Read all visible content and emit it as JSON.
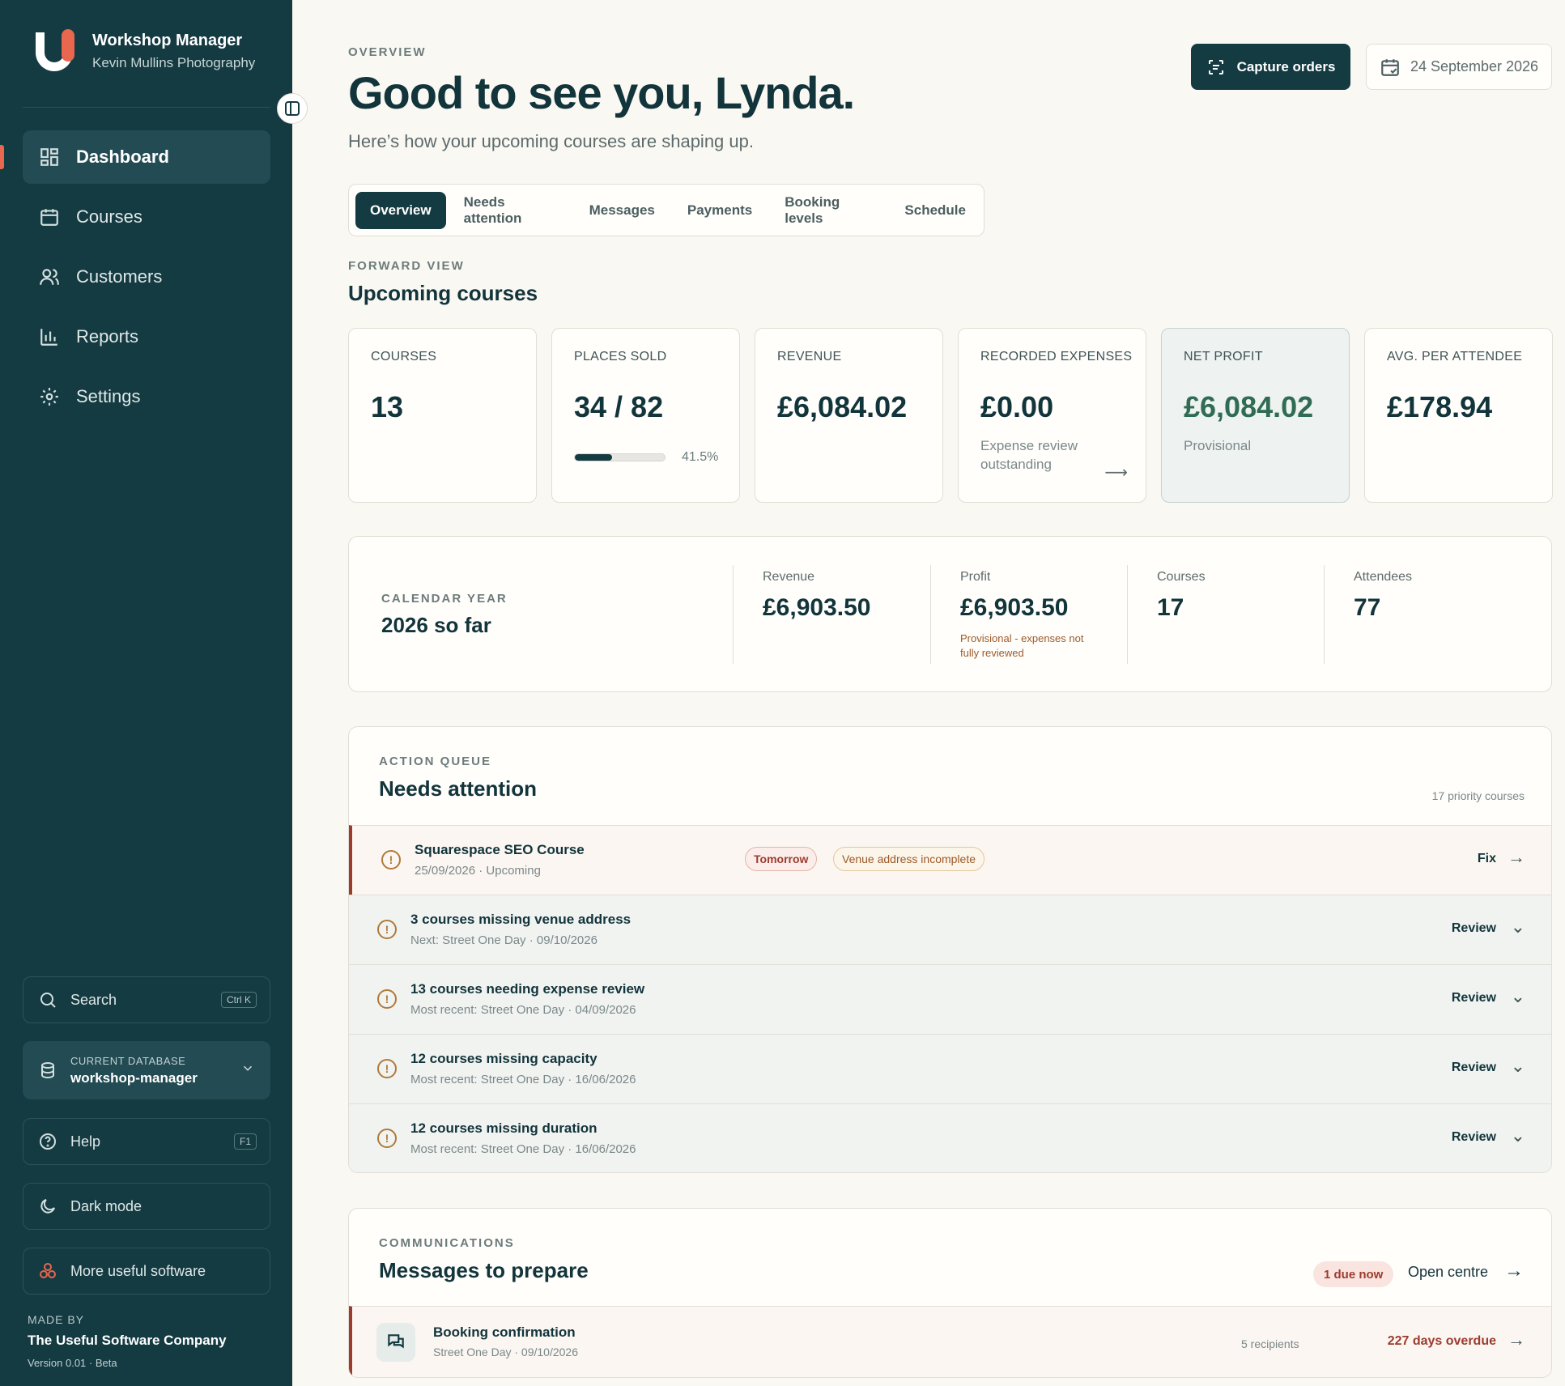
{
  "app": {
    "title": "Workshop Manager",
    "subtitle": "Kevin Mullins Photography"
  },
  "nav": [
    {
      "label": "Dashboard",
      "icon": "dashboard-icon",
      "active": true
    },
    {
      "label": "Courses",
      "icon": "calendar-icon"
    },
    {
      "label": "Customers",
      "icon": "users-icon"
    },
    {
      "label": "Reports",
      "icon": "bar-chart-icon"
    },
    {
      "label": "Settings",
      "icon": "gear-icon"
    }
  ],
  "sidebar_bottom": {
    "search_label": "Search",
    "search_shortcut": "Ctrl K",
    "db_label": "CURRENT DATABASE",
    "db_name": "workshop-manager",
    "help_label": "Help",
    "help_shortcut": "F1",
    "dark_mode_label": "Dark mode",
    "more_software_label": "More useful software",
    "made_by_label": "MADE BY",
    "company": "The Useful Software Company",
    "version": "Version 0.01 · Beta"
  },
  "header": {
    "eyebrow": "OVERVIEW",
    "title": "Good to see you, Lynda.",
    "subtitle": "Here’s how your upcoming courses are shaping up.",
    "capture_label": "Capture orders",
    "date": "24 September 2026"
  },
  "tabs": [
    "Overview",
    "Needs attention",
    "Messages",
    "Payments",
    "Booking levels",
    "Schedule"
  ],
  "forward_view": {
    "eyebrow": "FORWARD VIEW",
    "title": "Upcoming courses",
    "kpis": [
      {
        "label": "COURSES",
        "value": "13"
      },
      {
        "label": "PLACES SOLD",
        "value": "34 / 82",
        "progress": 0.415,
        "progress_label": "41.5%"
      },
      {
        "label": "REVENUE",
        "value": "£6,084.02"
      },
      {
        "label": "RECORDED EXPENSES",
        "value": "£0.00",
        "note": "Expense review outstanding"
      },
      {
        "label": "NET PROFIT",
        "value": "£6,084.02",
        "note": "Provisional"
      },
      {
        "label": "AVG. PER ATTENDEE",
        "value": "£178.94"
      }
    ]
  },
  "calendar_year": {
    "eyebrow": "CALENDAR YEAR",
    "title": "2026 so far",
    "revenue_label": "Revenue",
    "revenue": "£6,903.50",
    "profit_label": "Profit",
    "profit": "£6,903.50",
    "profit_note": "Provisional - expenses not fully reviewed",
    "courses_label": "Courses",
    "courses": "17",
    "attendees_label": "Attendees",
    "attendees": "77"
  },
  "action_queue": {
    "eyebrow": "ACTION QUEUE",
    "title": "Needs attention",
    "count": "17 priority courses",
    "rows": [
      {
        "title": "Squarespace SEO Course",
        "sub": "25/09/2026 · Upcoming",
        "pill_1": "Tomorrow",
        "pill_2": "Venue address incomplete",
        "action": "Fix"
      },
      {
        "title": "3 courses missing venue address",
        "sub": "Next: Street One Day · 09/10/2026",
        "action": "Review"
      },
      {
        "title": "13 courses needing expense review",
        "sub": "Most recent: Street One Day · 04/09/2026",
        "action": "Review"
      },
      {
        "title": "12 courses missing capacity",
        "sub": "Most recent: Street One Day · 16/06/2026",
        "action": "Review"
      },
      {
        "title": "12 courses missing duration",
        "sub": "Most recent: Street One Day · 16/06/2026",
        "action": "Review"
      }
    ]
  },
  "communications": {
    "eyebrow": "COMMUNICATIONS",
    "title": "Messages to prepare",
    "due_label": "1 due now",
    "open_label": "Open centre",
    "message": {
      "title": "Booking confirmation",
      "sub": "Street One Day · 09/10/2026",
      "recipients": "5 recipients",
      "overdue": "227 days overdue"
    }
  }
}
